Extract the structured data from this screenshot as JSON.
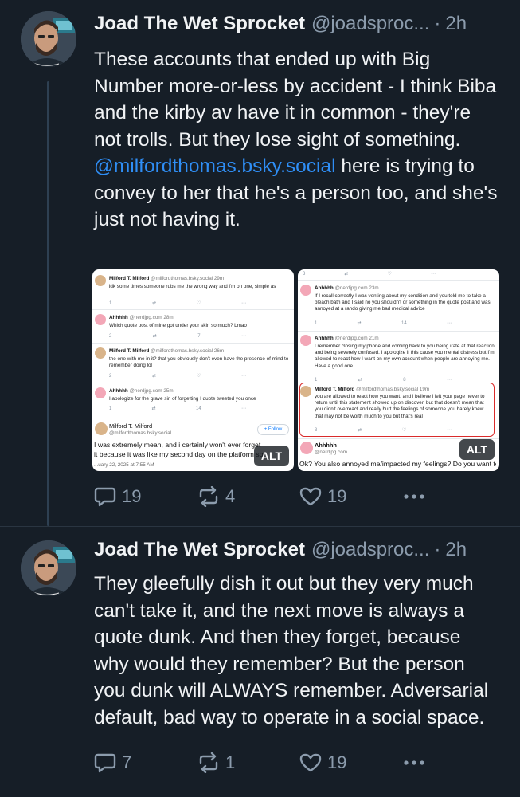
{
  "posts": [
    {
      "author_name": "Joad The Wet Sprocket",
      "handle": "@joadsproc...",
      "separator": "·",
      "time": "2h",
      "text_before_mention": "These accounts that ended up with Big Number more-or-less by accident - I think Biba and the kirby av have it in common - they're not trolls. But they lose sight of something.",
      "mention": "@milfordthomas.bsky.social",
      "text_after_mention": " here is trying to convey to her that he's a person too, and she's just not having it.",
      "reply_count": "19",
      "repost_count": "4",
      "like_count": "19",
      "images": [
        {
          "alt_badge": "ALT",
          "posts": [
            {
              "name": "Milford T. Milford",
              "handle": "@milfordthomas.bsky.social",
              "time": "29m",
              "text": "idk some times someone rubs me the wrong way and i'm on one, simple as",
              "replies": "1",
              "reposts": "",
              "likes": ""
            },
            {
              "name": "Ahhhhh",
              "handle": "@nerdjpg.com",
              "time": "28m",
              "text": "Which quote post of mine got under your skin so much? Lmao",
              "replies": "2",
              "reposts": "",
              "likes": "7"
            },
            {
              "name": "Milford T. Milford",
              "handle": "@milfordthomas.bsky.social",
              "time": "26m",
              "text": "the one with me in it? that you obviously don't even have the presence of mind to remember doing lol",
              "replies": "2",
              "reposts": "",
              "likes": ""
            },
            {
              "name": "Ahhhhh",
              "handle": "@nerdjpg.com",
              "time": "25m",
              "text": "I apologize for the grave sin of forgetting I quote tweeted you once",
              "replies": "1",
              "reposts": "",
              "likes": "14"
            }
          ],
          "focus_name": "Milford T. Milford",
          "focus_handle": "@milfordthomas.bsky.social",
          "follow_label": "+ Follow",
          "focus_text": "I was extremely mean, and i certainly won't ever forget it because it was like my second day on the platform so",
          "focus_date": "...uary 22, 2025 at 7:55 AM"
        },
        {
          "alt_badge": "ALT",
          "top_counts": {
            "replies": "3"
          },
          "posts": [
            {
              "name": "Ahhhhh",
              "handle": "@nerdjpg.com",
              "time": "23m",
              "text": "If I recall correctly I was venting about my condition and you told me to take a bleach bath and I said no you shouldn't or something in the quote post and was annoyed at a rando giving me bad medical advice",
              "replies": "1",
              "reposts": "",
              "likes": "14"
            },
            {
              "name": "Ahhhhh",
              "handle": "@nerdjpg.com",
              "time": "21m",
              "text": "I remember closing my phone and coming back to you being irate at that reaction and being severely confused. I apologize if this cause you mental distress but I'm allowed to react how I want on my own account when people are annoying me. Have a good one",
              "replies": "1",
              "reposts": "",
              "likes": "8"
            },
            {
              "name": "Milford T. Milford",
              "handle": "@milfordthomas.bsky.social",
              "time": "19m",
              "text": "you are allowed to react how you want, and i believe i left your page never to return until this statement showed up on discover, but that doesn't mean that you didn't overreact and really hurt the feelings of someone you barely knew. that may not be worth much to you but that's real",
              "replies": "3",
              "reposts": "",
              "likes": ""
            }
          ],
          "focus_name": "Ahhhhh",
          "focus_handle": "@nerdjpg.com",
          "focus_text": "Ok? You also annoyed me/impacted my feelings? Do you want to"
        }
      ]
    },
    {
      "author_name": "Joad The Wet Sprocket",
      "handle": "@joadsproc...",
      "separator": "·",
      "time": "2h",
      "text": "They gleefully dish it out but they very much can't take it, and the next move is always a quote dunk. And then they forget, because why would they remember? But the person you dunk will ALWAYS remember. Adversarial default, bad way to operate in a social space.",
      "reply_count": "7",
      "repost_count": "1",
      "like_count": "19"
    }
  ],
  "colors": {
    "background": "#161e27",
    "text": "#f1f3f5",
    "muted": "#8c9cad",
    "mention": "#2f8ef5",
    "thread_line": "#2e4052"
  },
  "icons": {
    "reply": "speech-bubble-icon",
    "repost": "repost-arrows-icon",
    "like": "heart-icon",
    "more": "more-dots-icon"
  }
}
